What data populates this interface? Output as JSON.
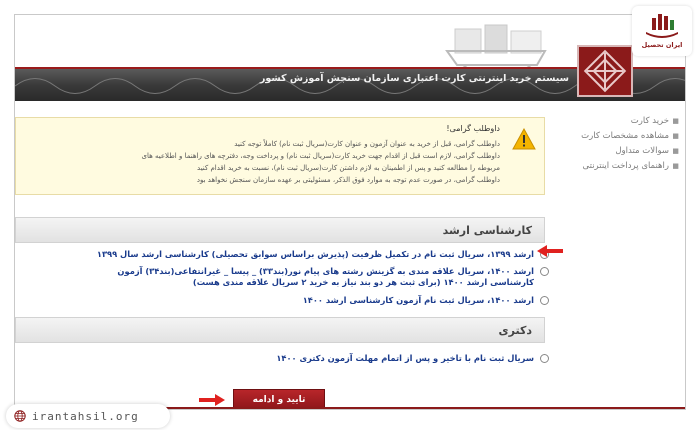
{
  "header": {
    "title": "سیستم خرید اینترنتی کارت اعتباری سازمان سنجش آموزش کشور"
  },
  "sidebar": {
    "items": [
      {
        "label": "خرید کارت"
      },
      {
        "label": "مشاهده مشخصات کارت"
      },
      {
        "label": "سوالات متداول"
      },
      {
        "label": "راهنمای پرداخت اینترنتی"
      }
    ]
  },
  "notice": {
    "title": "داوطلب گرامی!",
    "lines": [
      "داوطلب گرامی، قبل از خرید به عنوان آزمون و عنوان کارت(سریال ثبت نام) کاملاً توجه کنید",
      "داوطلب گرامی، لازم است قبل از اقدام جهت خرید کارت(سریال ثبت نام) و پرداخت وجه، دفترچه های راهنما و اطلاعیه های",
      "مربوطه را مطالعه کنید و پس از اطمینان به لازم داشتن کارت(سریال ثبت نام)، نسبت به خرید اقدام کنید",
      "داوطلب گرامی، در صورت عدم توجه به موارد فوق الذکر، مسئولیتی بر عهده سازمان سنجش نخواهد بود"
    ]
  },
  "sections": [
    {
      "title": "کارشناسی ارشد",
      "options": [
        "ارشد ۱۳۹۹، سریال ثبت نام در تکمیل ظرفیت (پذیرش براساس سوابق تحصیلی) کارشناسی ارشد سال ۱۳۹۹",
        "ارشد ۱۴۰۰، سریال علاقه مندی به گزینش رشته های پیام نور(بند۳۳) _ پیسا _ غیرانتفاعی(بند۳۴) آزمون کارشناسی ارشد ۱۴۰۰ (برای ثبت هر دو بند نیاز به خرید ۲ سریال علاقه مندی هست)",
        "ارشد ۱۴۰۰، سریال ثبت نام آزمون کارشناسی ارشد ۱۴۰۰"
      ]
    },
    {
      "title": "دکتری",
      "options": [
        "سریال ثبت نام با تاخیر و پس از اتمام مهلت آزمون دکتری ۱۴۰۰"
      ]
    }
  ],
  "submit": {
    "label": "تایید و ادامه"
  },
  "watermark": {
    "site": "irantahsil.org",
    "brand": "ایران تحصیل"
  },
  "colors": {
    "accent": "#8b1a1a",
    "link": "#1a3b8c",
    "arrow": "#e0211f"
  }
}
